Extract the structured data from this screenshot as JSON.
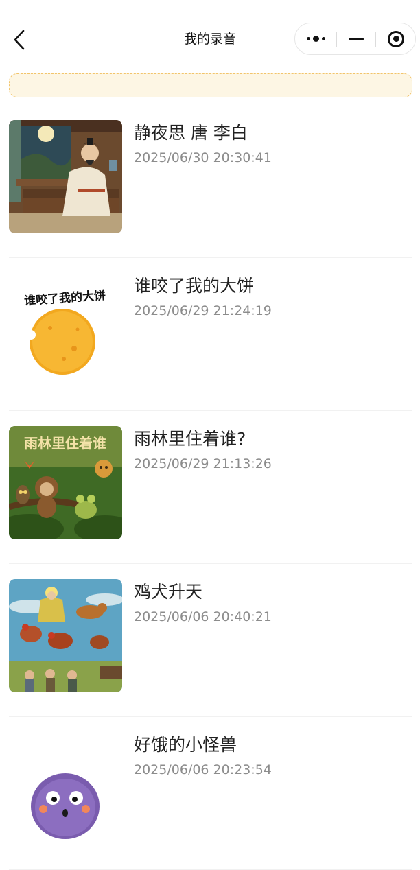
{
  "header": {
    "title": "我的录音",
    "back_icon": "chevron-left-icon",
    "capsule": {
      "more_icon": "more-dots-icon",
      "minimize_icon": "minimize-icon",
      "close_icon": "target-circle-icon"
    }
  },
  "notice": {
    "text": ""
  },
  "recordings": [
    {
      "title": "静夜思 唐 李白",
      "time": "2025/06/30 20:30:41",
      "cover": "scholar-moon-illustration"
    },
    {
      "title": "谁咬了我的大饼",
      "time": "2025/06/29 21:24:19",
      "cover": "bitten-pancake-illustration",
      "cover_text": "谁咬了我的大饼"
    },
    {
      "title": "雨林里住着谁?",
      "time": "2025/06/29 21:13:26",
      "cover": "rainforest-animals-illustration",
      "cover_text": "雨林里住着谁"
    },
    {
      "title": "鸡犬升天",
      "time": "2025/06/06 20:40:21",
      "cover": "flying-chickens-dog-illustration"
    },
    {
      "title": "好饿的小怪兽",
      "time": "2025/06/06 20:23:54",
      "cover": "purple-furry-monster-illustration"
    }
  ],
  "colors": {
    "notice_bg": "#fdf6e4",
    "notice_border": "#f2c46a",
    "title_text": "#222222",
    "time_text": "#8c8c8c"
  }
}
